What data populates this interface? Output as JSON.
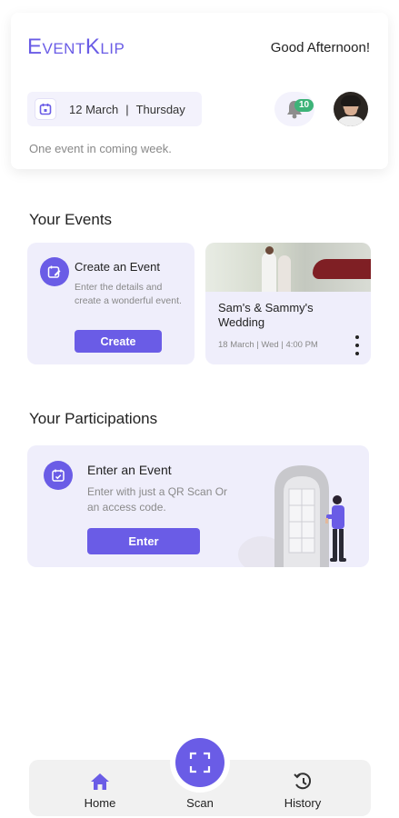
{
  "header": {
    "logo": "EventKlip",
    "greeting": "Good Afternoon!",
    "date_day": "12 March",
    "date_weekday": "Thursday",
    "notification_count": "10",
    "subtitle": "One event in coming week."
  },
  "your_events": {
    "title": "Your Events",
    "create_card": {
      "title": "Create an Event",
      "description": "Enter the details and create a wonderful event.",
      "button": "Create"
    },
    "event_card": {
      "name": "Sam's & Sammy's Wedding",
      "meta": "18 March | Wed | 4:00 PM"
    }
  },
  "participations": {
    "title": "Your Participations",
    "card": {
      "title": "Enter an Event",
      "description": "Enter with just a QR Scan Or an access code.",
      "button": "Enter"
    }
  },
  "bottom_nav": {
    "home": "Home",
    "scan": "Scan",
    "history": "History"
  },
  "colors": {
    "accent": "#6a5ce6",
    "card_bg": "#efeefb",
    "badge": "#3db378"
  },
  "icons": [
    "calendar-icon",
    "bell-icon",
    "edit-calendar-icon",
    "more-vertical-icon",
    "calendar-check-icon",
    "home-icon",
    "scan-icon",
    "history-icon"
  ]
}
